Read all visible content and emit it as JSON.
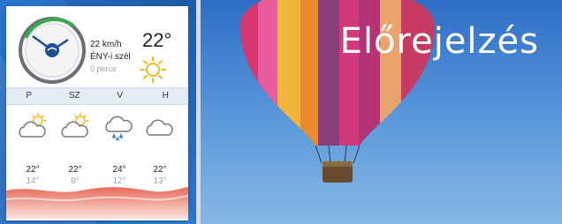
{
  "widget": {
    "wind_speed": "22 km/h",
    "wind_direction": "ÉNY-i szél",
    "wind_time": "0 perce",
    "temperature_now": "22°"
  },
  "days": [
    "P",
    "SZ",
    "V",
    "H"
  ],
  "forecast": [
    {
      "icon": "partly-cloudy-icon",
      "high": "22°",
      "low": "14°"
    },
    {
      "icon": "partly-cloudy-icon",
      "high": "22°",
      "low": "8°"
    },
    {
      "icon": "rain-cloud-icon",
      "high": "24°",
      "low": "12°"
    },
    {
      "icon": "cloud-icon",
      "high": "22°",
      "low": "13°"
    }
  ],
  "promo": {
    "title": "Előrejelzés"
  },
  "colors": {
    "accent_blue": "#1f63b8",
    "sun": "#f5b820",
    "gauge_green": "#39a950"
  }
}
